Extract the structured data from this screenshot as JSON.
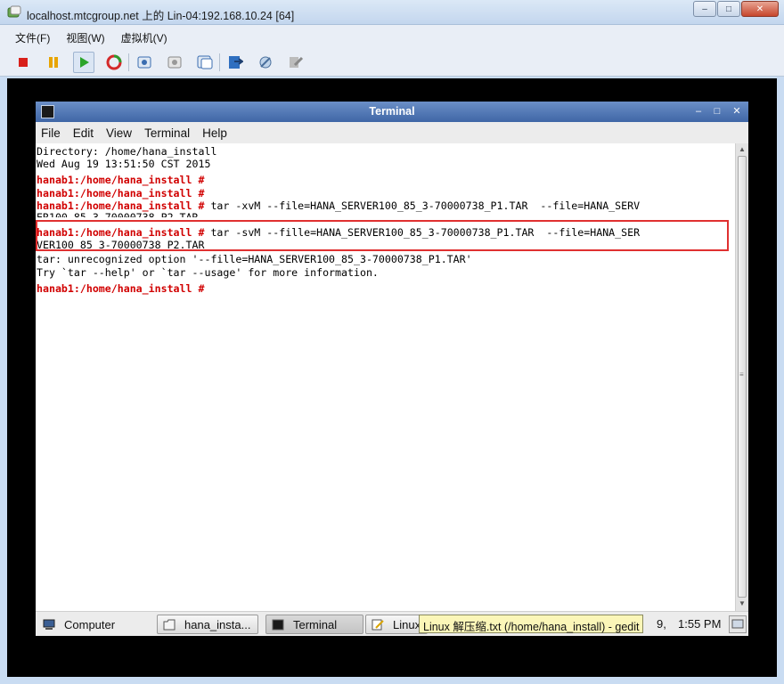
{
  "host_window": {
    "title": "localhost.mtcgroup.net 上的 Lin-04:192.168.10.24 [64]",
    "controls": {
      "minimize": "–",
      "maximize": "□",
      "close": "✕"
    },
    "menu": [
      "文件(F)",
      "视图(W)",
      "虚拟机(V)"
    ],
    "toolbar": [
      "stop",
      "pause",
      "play",
      "reset",
      "snapshot-take",
      "snapshot-revert",
      "snapshot-manager",
      "console-settings",
      "vm-settings",
      "edit-settings"
    ],
    "accent_color": "#c9dcf2"
  },
  "terminal": {
    "title": "Terminal",
    "controls": {
      "minimize": "–",
      "maximize": "□",
      "close": "✕"
    },
    "menu": [
      "File",
      "Edit",
      "View",
      "Terminal",
      "Help"
    ],
    "prompt": "hanab1:/home/hana_install #",
    "lines": {
      "l1": "Directory: /home/hana_install",
      "l2": "Wed Aug 19 13:51:50 CST 2015",
      "cmd1": " tar -xvM --file=HANA_SERVER100_85_3-70000738_P1.TAR  --file=HANA_SERV",
      "cmd1_wrap": "ER100_85_3-70000738_P2.TAR",
      "cmd2": " tar -svM --fille=HANA_SERVER100_85_3-70000738_P1.TAR  --file=HANA_SER",
      "cmd2_wrap": "VER100_85_3-70000738_P2.TAR",
      "err1": "tar: unrecognized option '--fille=HANA_SERVER100_85_3-70000738_P1.TAR'",
      "err2": "Try `tar --help' or `tar --usage' for more information."
    },
    "prompt_color": "#d10000"
  },
  "taskbar": {
    "computer": "Computer",
    "items": [
      "hana_insta...",
      "Terminal",
      "Linux"
    ],
    "tooltip": "Linux 解压缩.txt (/home/hana_install) - gedit",
    "date_fragment": "9,",
    "clock": "1:55 PM"
  }
}
